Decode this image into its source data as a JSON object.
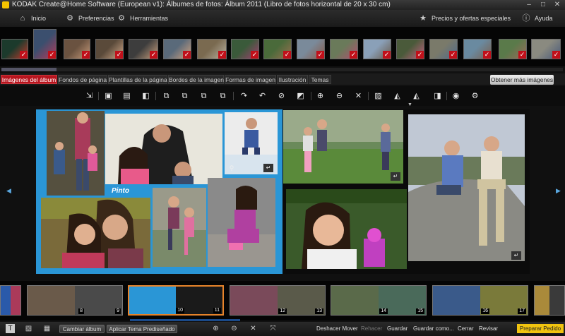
{
  "window": {
    "title": "KODAK Create@Home Software (European v1): Álbumes de fotos: Álbum 2011 (Libro de fotos horizontal de 20 x 30 cm)",
    "min": "–",
    "max": "□",
    "close": "✕"
  },
  "nav": {
    "home": "Inicio",
    "preferences": "Preferencias",
    "tools": "Herramientas",
    "offers": "Precios y ofertas especiales",
    "help": "Ayuda"
  },
  "tray": {
    "photos": [
      {
        "c1": "#1c3a2c",
        "c2": "#c0392b"
      },
      {
        "c1": "#3b4f6e",
        "c2": "#b33a5a"
      },
      {
        "c1": "#6a5240",
        "c2": "#c79b7a"
      },
      {
        "c1": "#5a4a3a",
        "c2": "#d1a88a"
      },
      {
        "c1": "#3d3d3d",
        "c2": "#caa07e"
      },
      {
        "c1": "#5a6a7a",
        "c2": "#d2a27f"
      },
      {
        "c1": "#7a6a50",
        "c2": "#b8b0a0"
      },
      {
        "c1": "#3a5a3a",
        "c2": "#a04070"
      },
      {
        "c1": "#4a6a3a",
        "c2": "#9a7050"
      },
      {
        "c1": "#7a8a9a",
        "c2": "#8a5a4a"
      },
      {
        "c1": "#6a7a5a",
        "c2": "#b05070"
      },
      {
        "c1": "#8aa0b8",
        "c2": "#6a5a4a"
      },
      {
        "c1": "#4a5a3a",
        "c2": "#c06080"
      },
      {
        "c1": "#7a7a6a",
        "c2": "#506a8a"
      },
      {
        "c1": "#6a8aa0",
        "c2": "#7a6050"
      },
      {
        "c1": "#5a7a4a",
        "c2": "#9a6a5a"
      },
      {
        "c1": "#8a8a80",
        "c2": "#4a5a7a"
      },
      {
        "c1": "#6a5a4a",
        "c2": "#d0a080"
      }
    ]
  },
  "tabs": [
    {
      "label": "Imágenes del álbum",
      "active": true
    },
    {
      "label": "Fondos de página"
    },
    {
      "label": "Plantillas de la página"
    },
    {
      "label": "Bordes de la imagen"
    },
    {
      "label": "Formas de imagen"
    },
    {
      "label": "Ilustración"
    },
    {
      "label": "Temas"
    }
  ],
  "more_images": "Obtener más imágenes",
  "canvas": {
    "caption": "Pinto"
  },
  "pages": [
    {
      "num": "8",
      "num2": "9"
    },
    {
      "num": "10",
      "num2": "11"
    },
    {
      "num": "12",
      "num2": "13"
    },
    {
      "num": "14",
      "num2": "15"
    },
    {
      "num": "16",
      "num2": "17"
    }
  ],
  "bottom": {
    "change_album": "Cambiar álbum",
    "apply_theme": "Aplicar Tema Prediseñado",
    "undo": "Deshacer Mover",
    "redo": "Rehacer",
    "save": "Guardar",
    "save_as": "Guardar como...",
    "close": "Cerrar",
    "review": "Revisar",
    "order": "Preparar Pedido"
  }
}
